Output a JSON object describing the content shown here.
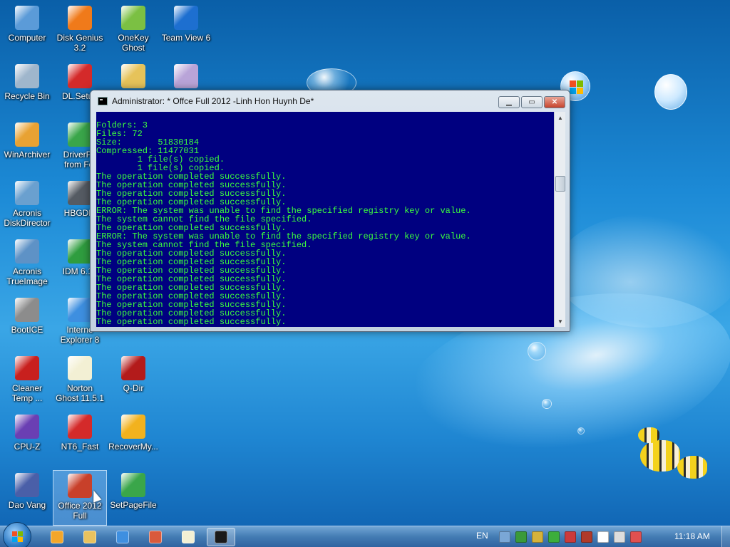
{
  "desktop": {
    "icons": [
      {
        "label": "Computer",
        "icon": "computer-icon",
        "color": "#5b9bd8"
      },
      {
        "label": "Disk Genius\n3.2",
        "icon": "disk-genius-icon",
        "color": "#f07a1a"
      },
      {
        "label": "OneKey\nGhost",
        "icon": "onekey-ghost-icon",
        "color": "#7bc043"
      },
      {
        "label": "Team View 6",
        "icon": "teamviewer-icon",
        "color": "#1d6fd0"
      },
      {
        "label": "Recycle Bin",
        "icon": "recycle-bin-icon",
        "color": "#9fb6cc"
      },
      {
        "label": "DL.Setup",
        "icon": "dl-setup-icon",
        "color": "#d42a2a"
      },
      {
        "label": "",
        "icon": "paint-palette-icon",
        "color": "#e6c35a"
      },
      {
        "label": "",
        "icon": "cd-disc-icon",
        "color": "#b9a4d8"
      },
      {
        "label": "WinArchiver",
        "icon": "winarchiver-icon",
        "color": "#e8a233"
      },
      {
        "label": "DriverPa\nfrom Fol",
        "icon": "driver-pack-icon",
        "color": "#3aa64a"
      },
      {
        "label": "Acronis\nDiskDirector",
        "icon": "acronis-diskdirector-icon",
        "color": "#6aa0cf"
      },
      {
        "label": "HBGDM",
        "icon": "tools-icon",
        "color": "#555b63"
      },
      {
        "label": "Acronis\nTrueImage",
        "icon": "acronis-trueimage-icon",
        "color": "#5e92c6"
      },
      {
        "label": "IDM 6.12",
        "icon": "idm-icon",
        "color": "#2f9d3f"
      },
      {
        "label": "BootICE",
        "icon": "bootice-icon",
        "color": "#8c8c8c"
      },
      {
        "label": "Interne\nExplorer 8",
        "icon": "internet-explorer-icon",
        "color": "#3e8fe0"
      },
      {
        "label": "Cleaner\nTemp ...",
        "icon": "ccleaner-icon",
        "color": "#c8201e"
      },
      {
        "label": "Norton\nGhost 11.5.1",
        "icon": "norton-ghost-icon",
        "color": "#f3f0d4"
      },
      {
        "label": "Q-Dir",
        "icon": "q-dir-icon",
        "color": "#b31b1b"
      },
      {
        "label": "CPU-Z",
        "icon": "cpu-z-icon",
        "color": "#6a3fb3"
      },
      {
        "label": "NT6_Fast",
        "icon": "nt6-fast-icon",
        "color": "#d42a2a"
      },
      {
        "label": "RecoverMy...",
        "icon": "recover-my-files-icon",
        "color": "#f2b21e"
      },
      {
        "label": "Dao Vang",
        "icon": "dao-vang-icon",
        "color": "#4a5fa8"
      },
      {
        "label": "Office 2012\nFull",
        "icon": "office-installer-icon",
        "color": "#c8402a"
      },
      {
        "label": "SetPageFile",
        "icon": "setpagefile-icon",
        "color": "#3aa64a"
      }
    ]
  },
  "window": {
    "title": "Administrator:  * Offce Full 2012 -Linh Hon Huynh De*",
    "minimize_label": "▁",
    "maximize_label": "▭",
    "close_label": "✕",
    "console_lines": [
      "Folders: 3",
      "Files: 72",
      "Size:       51830184",
      "Compressed: 11477031",
      "        1 file(s) copied.",
      "        1 file(s) copied.",
      "The operation completed successfully.",
      "The operation completed successfully.",
      "The operation completed successfully.",
      "The operation completed successfully.",
      "ERROR: The system was unable to find the specified registry key or value.",
      "The system cannot find the file specified.",
      "The operation completed successfully.",
      "ERROR: The system was unable to find the specified registry key or value.",
      "The system cannot find the file specified.",
      "The operation completed successfully.",
      "The operation completed successfully.",
      "The operation completed successfully.",
      "The operation completed successfully.",
      "The operation completed successfully.",
      "The operation completed successfully.",
      "The operation completed successfully.",
      "The operation completed successfully.",
      "The operation completed successfully."
    ],
    "console_bg": "#000080",
    "console_fg": "#3cff3c"
  },
  "taskbar": {
    "start_label": "Start",
    "language": "EN",
    "clock": "11:18 AM",
    "pinned": [
      {
        "name": "media-player-icon",
        "color": "#f3a62a"
      },
      {
        "name": "file-explorer-icon",
        "color": "#e9c25e"
      },
      {
        "name": "internet-explorer-icon",
        "color": "#3e8fe0"
      },
      {
        "name": "network-tool-icon",
        "color": "#d95a3c"
      },
      {
        "name": "ghost-icon",
        "color": "#f3f0d4"
      },
      {
        "name": "command-prompt-icon",
        "color": "#1a1a1a"
      }
    ],
    "tray": [
      {
        "name": "usb-icon",
        "color": "#7aa7d6"
      },
      {
        "name": "network-globe-icon",
        "color": "#3a9a3a"
      },
      {
        "name": "antivirus-icon",
        "color": "#d6b23a"
      },
      {
        "name": "update-icon",
        "color": "#3cae3c"
      },
      {
        "name": "security-shield-icon",
        "color": "#cc3a3a"
      },
      {
        "name": "tool-icon",
        "color": "#b03a2a"
      },
      {
        "name": "action-center-flag-icon",
        "color": "#ffffff"
      },
      {
        "name": "display-icon",
        "color": "#dddddd"
      },
      {
        "name": "volume-muted-icon",
        "color": "#e05050"
      }
    ]
  }
}
